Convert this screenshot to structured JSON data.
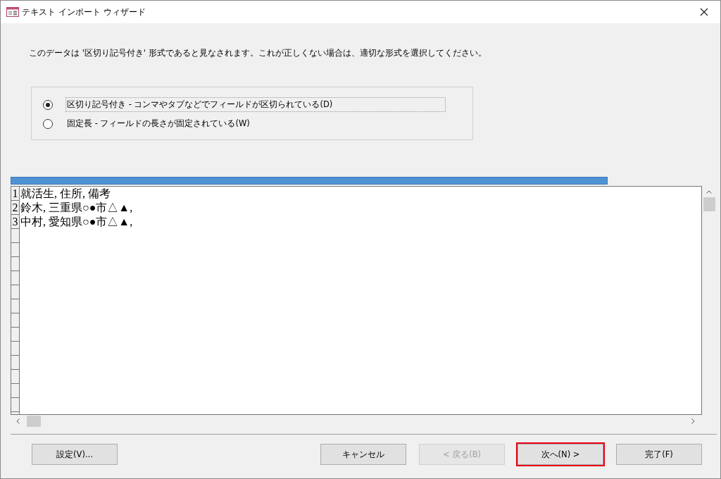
{
  "window": {
    "title": "テキスト インポート ウィザード"
  },
  "message": "このデータは '区切り記号付き' 形式であると見なされます。これが正しくない場合は、適切な形式を選択してください。",
  "format_options": [
    {
      "label": "区切り記号付き - コンマやタブなどでフィールドが区切られている(D)",
      "selected": true
    },
    {
      "label": "固定長 - フィールドの長さが固定されている(W)",
      "selected": false
    }
  ],
  "preview": {
    "rows": [
      {
        "number": "1",
        "text": "就活生, 住所, 備考"
      },
      {
        "number": "2",
        "text": "鈴木, 三重県○●市△▲,"
      },
      {
        "number": "3",
        "text": "中村, 愛知県○●市△▲,"
      }
    ]
  },
  "buttons": [
    {
      "label": "設定(V)...",
      "disabled": false,
      "highlighted": false
    },
    {
      "label": "キャンセル",
      "disabled": false,
      "highlighted": false
    },
    {
      "label": "< 戻る(B)",
      "disabled": true,
      "highlighted": false
    },
    {
      "label": "次へ(N) >",
      "disabled": false,
      "highlighted": true
    },
    {
      "label": "完了(F)",
      "disabled": false,
      "highlighted": false
    }
  ]
}
